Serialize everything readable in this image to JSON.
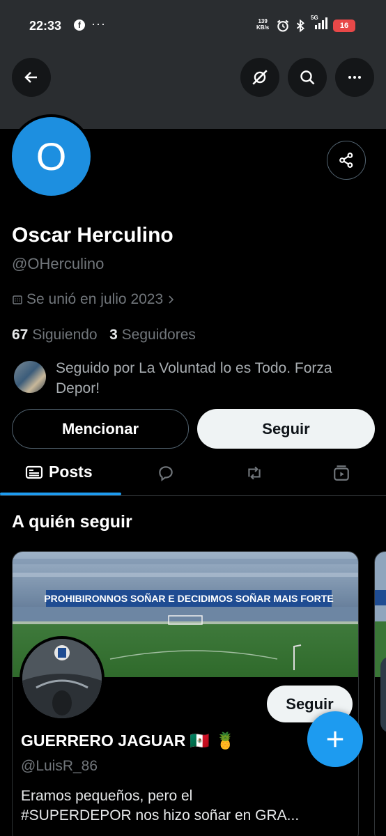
{
  "status_bar": {
    "time": "22:33",
    "facebook_icon": "f",
    "more": "···",
    "speed_top": "139",
    "speed_bottom": "KB/s",
    "network": "5G",
    "battery": "16"
  },
  "top_bar": {
    "back_icon": "back-arrow-icon",
    "icons": [
      "grok-icon",
      "search-icon",
      "more-icon"
    ]
  },
  "profile": {
    "avatar_letter": "O",
    "name": "Oscar Herculino",
    "handle": "@OHerculino",
    "joined": "Se unió en julio 2023",
    "following_count": "67",
    "following_label": "Siguiendo",
    "followers_count": "3",
    "followers_label": "Seguidores",
    "followed_by": "Seguido por La Voluntad lo es Todo. Forza Depor!"
  },
  "actions": {
    "mention": "Mencionar",
    "follow": "Seguir"
  },
  "tabs": {
    "posts": "Posts",
    "icons": [
      "reply-icon",
      "repost-icon",
      "media-icon"
    ]
  },
  "who_to_follow": {
    "title": "A quién seguir",
    "card": {
      "banner_text": "PROHIBIRONNOS SOÑAR E DECIDIMOS SOÑAR MAIS FORTE",
      "follow": "Seguir",
      "name": "GUERRERO JAGUAR",
      "emojis": "🇲🇽 🍍",
      "handle": "@LuisR_86",
      "bio_line1": "Eramos pequeños, pero el",
      "bio_line2": "#SUPERDEPOR  nos hizo soñar en GRA..."
    }
  },
  "colors": {
    "accent": "#1d9bf0",
    "avatar": "#1d8fe0",
    "header": "#2a2d30",
    "muted": "#71767b"
  }
}
